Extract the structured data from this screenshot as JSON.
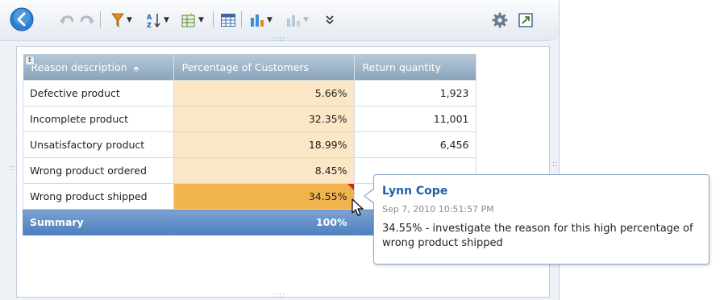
{
  "toolbar": {
    "icons": [
      "back-icon",
      "undo-icon",
      "redo-icon",
      "filter-icon",
      "sort-icon",
      "insert-icon",
      "table-view-icon",
      "chart-icon",
      "chart-type-icon",
      "more-icon",
      "settings-icon",
      "maximize-icon"
    ]
  },
  "table": {
    "headers": [
      "Reason description",
      "Percentage of Customers",
      "Return quantity"
    ],
    "rows": [
      {
        "reason": "Defective product",
        "pct": "5.66%",
        "qty": "1,923"
      },
      {
        "reason": "Incomplete product",
        "pct": "32.35%",
        "qty": "11,001"
      },
      {
        "reason": "Unsatisfactory product",
        "pct": "18.99%",
        "qty": "6,456"
      },
      {
        "reason": "Wrong product ordered",
        "pct": "8.45%",
        "qty": ""
      },
      {
        "reason": "Wrong product shipped",
        "pct": "34.55%",
        "qty": ""
      }
    ],
    "summary": {
      "label": "Summary",
      "pct": "100%"
    }
  },
  "comment": {
    "author": "Lynn Cope",
    "timestamp": "Sep 7, 2010 10:51:57 PM",
    "text": "34.55% - investigate the reason for this high percentage of wrong product shipped"
  },
  "colors": {
    "accent": "#1f5fa8",
    "highlight": "#f0b44c",
    "summary": "#4d7fbf"
  }
}
